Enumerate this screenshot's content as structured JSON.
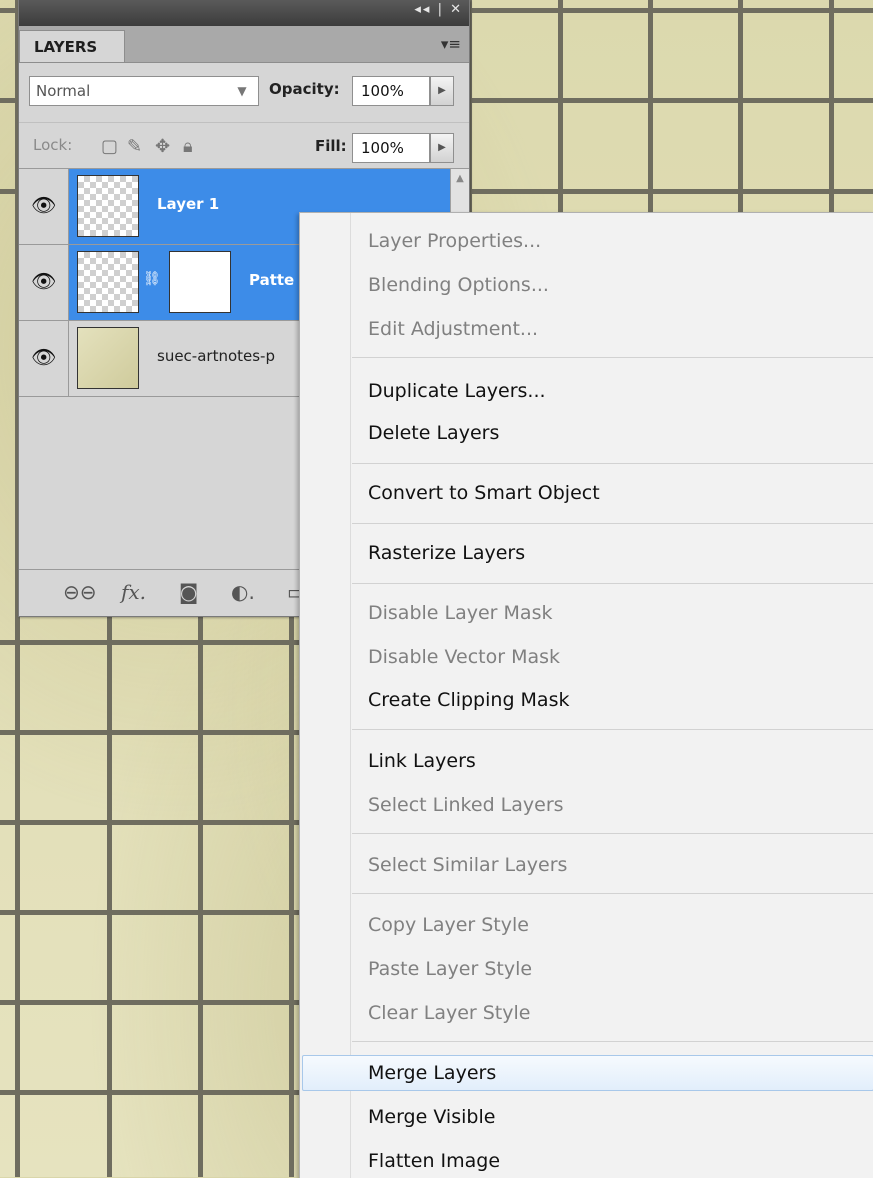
{
  "panel": {
    "tab_label": "LAYERS",
    "window_controls": "◂◂ | ✕",
    "blend_mode": "Normal",
    "opacity_label": "Opacity:",
    "opacity_value": "100%",
    "lock_label": "Lock:",
    "fill_label": "Fill:",
    "fill_value": "100%",
    "layers": [
      {
        "name": "Layer 1",
        "selected": true
      },
      {
        "name": "Patte",
        "selected": true
      },
      {
        "name": "suec-artnotes-p",
        "selected": false
      }
    ]
  },
  "context_menu": {
    "items": [
      {
        "label": "Layer Properties...",
        "enabled": false
      },
      {
        "label": "Blending Options...",
        "enabled": false
      },
      {
        "label": "Edit Adjustment...",
        "enabled": false
      },
      {
        "label": "Duplicate Layers...",
        "enabled": true
      },
      {
        "label": "Delete Layers",
        "enabled": true
      },
      {
        "label": "Convert to Smart Object",
        "enabled": true
      },
      {
        "label": "Rasterize Layers",
        "enabled": true
      },
      {
        "label": "Disable Layer Mask",
        "enabled": false
      },
      {
        "label": "Disable Vector Mask",
        "enabled": false
      },
      {
        "label": "Create Clipping Mask",
        "enabled": true
      },
      {
        "label": "Link Layers",
        "enabled": true
      },
      {
        "label": "Select Linked Layers",
        "enabled": false
      },
      {
        "label": "Select Similar Layers",
        "enabled": false
      },
      {
        "label": "Copy Layer Style",
        "enabled": false
      },
      {
        "label": "Paste Layer Style",
        "enabled": false
      },
      {
        "label": "Clear Layer Style",
        "enabled": false
      },
      {
        "label": "Merge Layers",
        "enabled": true,
        "highlighted": true
      },
      {
        "label": "Merge Visible",
        "enabled": true
      },
      {
        "label": "Flatten Image",
        "enabled": true
      }
    ]
  }
}
